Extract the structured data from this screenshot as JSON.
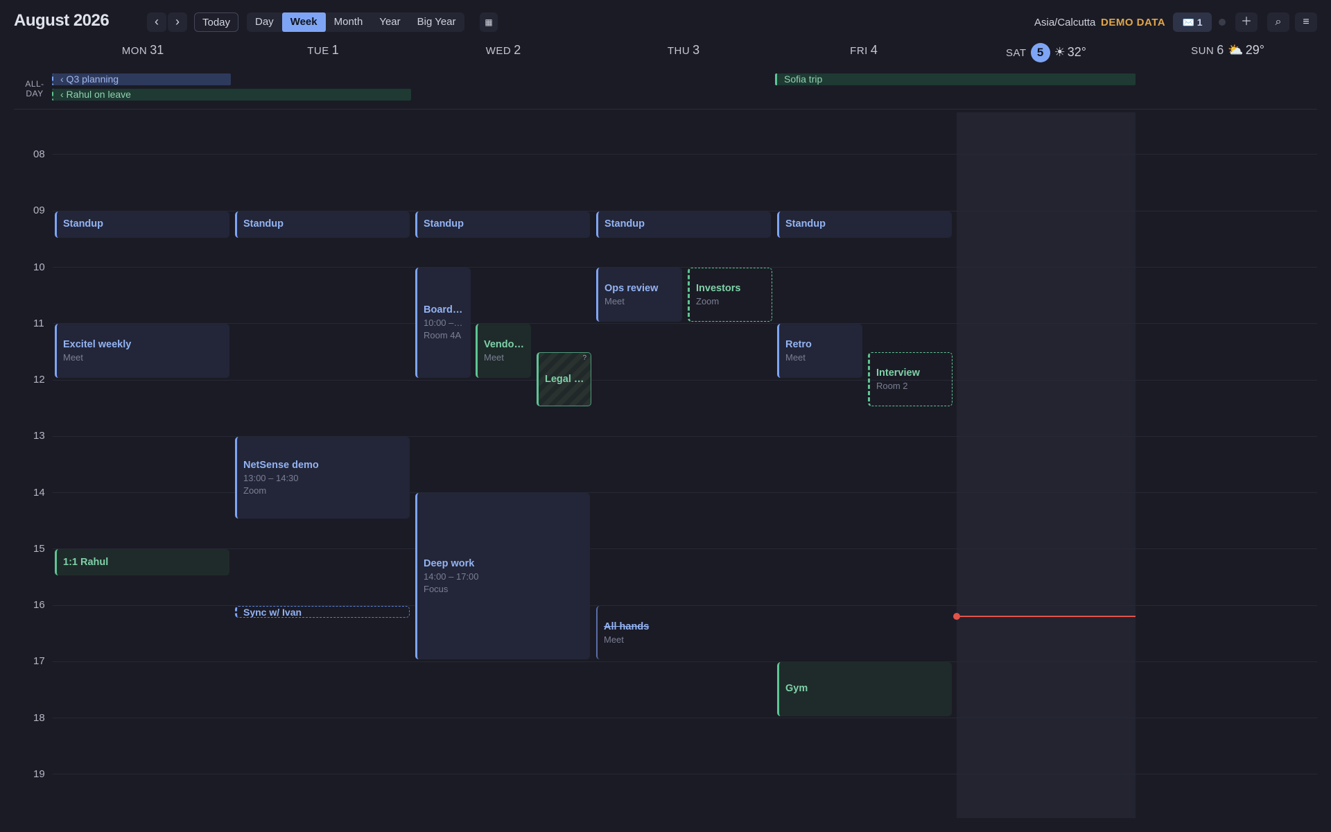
{
  "header": {
    "title": "August 2026",
    "prev_label": "‹",
    "next_label": "›",
    "today_label": "Today",
    "views": [
      "Day",
      "Week",
      "Month",
      "Year",
      "Big Year"
    ],
    "active_view": "Week",
    "grid_icon": "▦",
    "timezone": "Asia/Calcutta",
    "demo_label": "DEMO DATA",
    "mail_label": "✉️ 1",
    "add_icon": "＋",
    "search_icon": "⌕",
    "menu_icon": "≡"
  },
  "days": [
    {
      "name": "MON",
      "num": "31"
    },
    {
      "name": "TUE",
      "num": "1"
    },
    {
      "name": "WED",
      "num": "2"
    },
    {
      "name": "THU",
      "num": "3"
    },
    {
      "name": "FRI",
      "num": "4"
    },
    {
      "name": "SAT",
      "num": "5",
      "today": true,
      "weather_icon": "☀",
      "temp": "32°"
    },
    {
      "name": "SUN",
      "num": "6",
      "weather_icon": "⛅",
      "temp": "29°"
    }
  ],
  "allday": {
    "label_line1": "ALL-",
    "label_line2": "DAY",
    "events": [
      {
        "title": "‹ Q3 planning",
        "color": "blue"
      },
      {
        "title": "‹ Rahul on leave",
        "color": "green"
      },
      {
        "title": "Sofia trip",
        "color": "green"
      }
    ]
  },
  "hours": [
    "08",
    "09",
    "10",
    "11",
    "12",
    "13",
    "14",
    "15",
    "16",
    "17",
    "18",
    "19"
  ],
  "events": {
    "mon_standup": {
      "title": "Standup"
    },
    "tue_standup": {
      "title": "Standup"
    },
    "wed_standup": {
      "title": "Standup"
    },
    "thu_standup": {
      "title": "Standup"
    },
    "fri_standup": {
      "title": "Standup"
    },
    "excitel": {
      "title": "Excitel weekly",
      "sub": "Meet"
    },
    "rahul_1on1": {
      "title": "1:1 Rahul"
    },
    "netsense": {
      "title": "NetSense demo",
      "time": "13:00 – 14:30",
      "sub": "Zoom"
    },
    "sync_ivan": {
      "title": "Sync w/ Ivan"
    },
    "board": {
      "title": "Board …",
      "time": "10:00 –…",
      "sub": "Room 4A"
    },
    "vendor": {
      "title": "Vendo…",
      "sub": "Meet"
    },
    "legal": {
      "title": "Legal …",
      "flag": "?"
    },
    "deepwork": {
      "title": "Deep work",
      "time": "14:00 – 17:00",
      "sub": "Focus"
    },
    "ops": {
      "title": "Ops review",
      "sub": "Meet"
    },
    "investors": {
      "title": "Investors",
      "sub": "Zoom"
    },
    "allhands": {
      "title": "All hands",
      "sub": "Meet"
    },
    "retro": {
      "title": "Retro",
      "sub": "Meet"
    },
    "interview": {
      "title": "Interview",
      "sub": "Room 2"
    },
    "gym": {
      "title": "Gym"
    }
  }
}
